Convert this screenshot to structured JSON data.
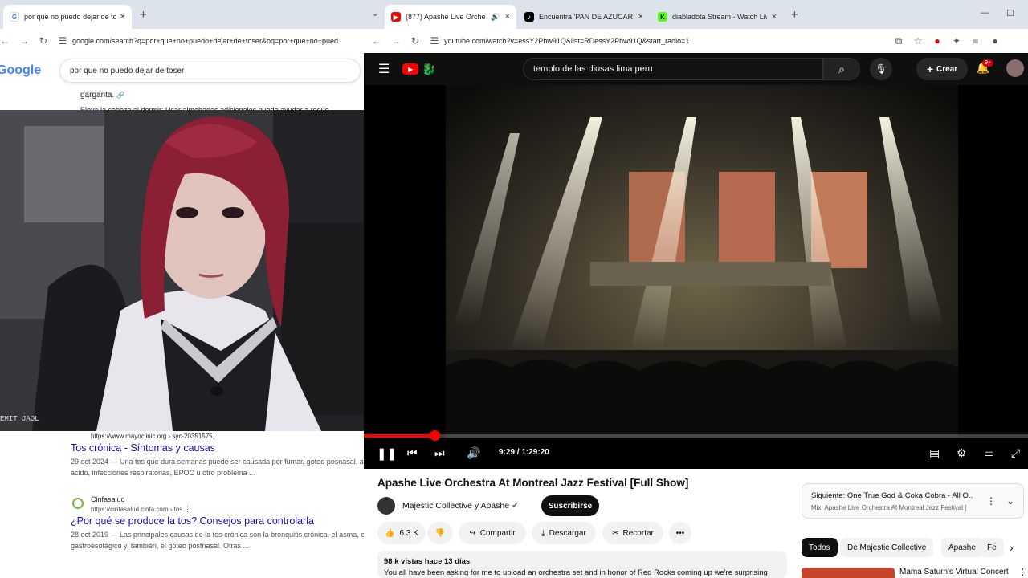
{
  "left_browser": {
    "tab": {
      "title": "por que no puedo dejar de tos",
      "close": "×"
    },
    "new_tab": "+",
    "url": "google.com/search?q=por+que+no+puedo+dejar+de+toser&oq=por+que+no+pued",
    "google_logo": "Google",
    "search_query": "por que no puedo dejar de toser",
    "snippet_top": "garganta.",
    "snippet_partial": "Eleva la cabeza al dormir: Usar almohadas adicionales puede ayudar a reduc",
    "results": [
      {
        "cite": "https://www.mayoclinic.org › syc-20351575",
        "title": "Tos crónica - Síntomas y causas",
        "snippet_l1": "29 oct 2024 — Una tos que dura semanas puede ser causada por fumar, goteo posnasal, as",
        "snippet_l2": "ácido, infecciones respiratorias, EPOC u otro problema ..."
      },
      {
        "site": "Cinfasalud",
        "cite": "https://cinfasalud.cinfa.com › tos",
        "title": "¿Por qué se produce la tos? Consejos para controlarla",
        "snippet_l1": "28 oct 2019 — Las principales causas de la tos crónica son la bronquitis crónica, el asma, e",
        "snippet_l2": "gastroesofágico y, también, el goteo postnasal. Otras ..."
      }
    ],
    "webcam_overlay_text": "EMIT JAOL"
  },
  "right_browser": {
    "tabs": [
      {
        "title": "(877) Apashe Live Orchestr",
        "active": true
      },
      {
        "title": "Encuentra 'PAN DE AZUCAR DI",
        "active": false
      },
      {
        "title": "diabladota Stream - Watch Live",
        "active": false
      }
    ],
    "new_tab": "+",
    "url": "youtube.com/watch?v=essY2Phw91Q&list=RDessY2Phw91Q&start_radio=1",
    "youtube": {
      "search_text": "templo de las diosas lima peru",
      "create_label": "Crear",
      "notif_badge": "9+",
      "time_display": "9:29 / 1:29:20",
      "progress": 0.106,
      "video_title": "Apashe Live Orchestra At Montreal Jazz Festival [Full Show]",
      "channel": "Majestic Collective y Apashe",
      "subscribe": "Suscribirse",
      "likes": "6.3 K",
      "share": "Compartir",
      "download": "Descargar",
      "clip": "Recortar",
      "views": "98 k vistas  hace 13 días",
      "description": "You all have been asking for me to upload an orchestra set and in honor of Red Rocks coming up we're surprising",
      "next_title": "Siguiente: One True God & Coka Cobra - All O...",
      "next_sub": "Mix: Apashe Live Orchestra At Montreal Jazz Festival [",
      "chips": [
        "Todos",
        "De Majestic Collective",
        "Apashe",
        "Fe"
      ],
      "related_title": "Mama Saturn's Virtual Concert"
    }
  },
  "colors": {
    "yt_red": "#ff0000",
    "link_blue": "#1a0dab",
    "yt_dark": "#0f0f0f"
  }
}
